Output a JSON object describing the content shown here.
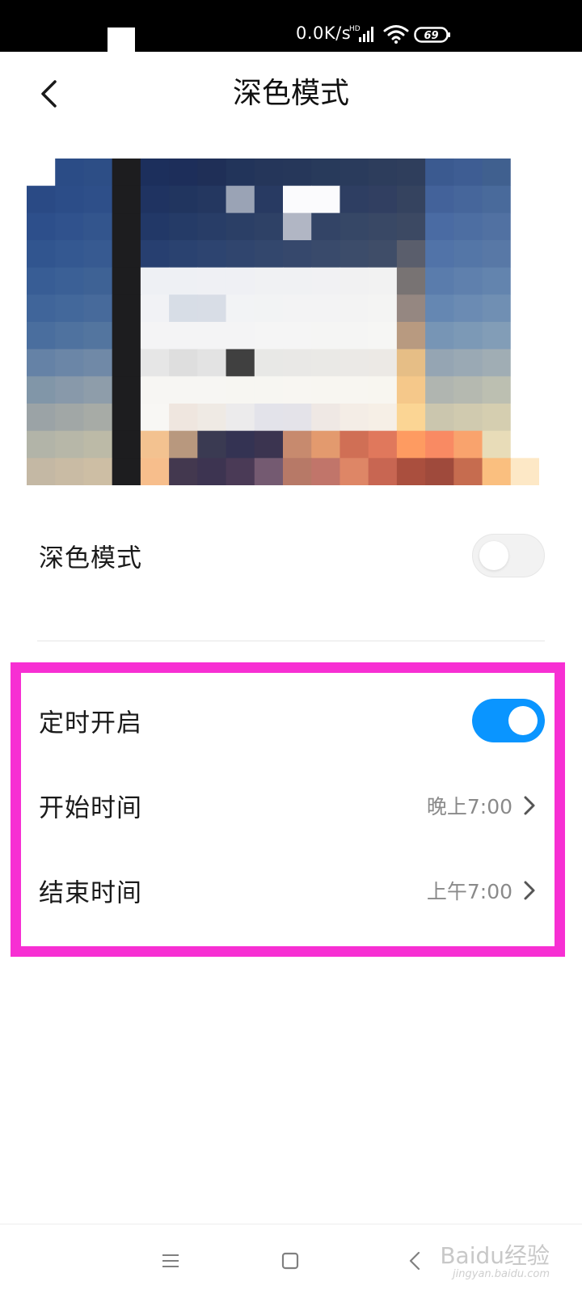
{
  "status_bar": {
    "network_speed": "0.0K/s",
    "signal_badge": "HD",
    "battery_level": "69",
    "icons": [
      "signal-icon",
      "wifi-icon",
      "battery-icon"
    ]
  },
  "header": {
    "title": "深色模式",
    "back_icon": "chevron-left-icon"
  },
  "preview": {
    "pixel_colors": [
      [
        "#ffffff",
        "#2b4c86",
        "#2d4e86",
        "#1d1d1f",
        "#1c2f5c",
        "#1d2e5a",
        "#1f2f57",
        "#22345a",
        "#25365a",
        "#26375a",
        "#283a5b",
        "#2a3b5c",
        "#2d3d5c",
        "#2f3e5c",
        "#3b5a90",
        "#3e5d93",
        "#40608f",
        "#ffffff"
      ],
      [
        "#2a4a85",
        "#2c4d88",
        "#2e4f89",
        "#1d1d1f",
        "#1f3361",
        "#21355f",
        "#243760",
        "#9aa3b5",
        "#283a62",
        "#fbfbfd",
        "#fbfbfd",
        "#2e3e62",
        "#313f61",
        "#35435f",
        "#43629a",
        "#46669b",
        "#496a9b",
        "#ffffff"
      ],
      [
        "#2d4f8b",
        "#30528d",
        "#33558d",
        "#1d1d1f",
        "#223867",
        "#253b67",
        "#283d67",
        "#2b3f66",
        "#2e4166",
        "#b1b6c4",
        "#334466",
        "#364766",
        "#394865",
        "#3c4963",
        "#4a6ba3",
        "#4d6ea2",
        "#5171a2",
        "#ffffff"
      ],
      [
        "#31558f",
        "#345891",
        "#375a91",
        "#1d1d1f",
        "#273f70",
        "#2a4270",
        "#2d4470",
        "#30456e",
        "#33476d",
        "#36486c",
        "#394a6b",
        "#3c4c6a",
        "#3f4d68",
        "#5a5e6c",
        "#5173a8",
        "#5476a7",
        "#5878a6",
        "#ffffff"
      ],
      [
        "#385d95",
        "#3b6096",
        "#3e6295",
        "#1d1d1f",
        "#eef0f4",
        "#eef0f4",
        "#eff0f4",
        "#eff0f4",
        "#f0f1f3",
        "#f0f1f3",
        "#f1f1f3",
        "#f1f1f2",
        "#f2f2f2",
        "#787373",
        "#5a7cac",
        "#5f80ad",
        "#6384ae",
        "#ffffff"
      ],
      [
        "#40659a",
        "#43689b",
        "#476a9b",
        "#1d1d1f",
        "#f1f2f5",
        "#d7dde6",
        "#d8dde6",
        "#f2f3f5",
        "#f2f3f4",
        "#f3f3f4",
        "#f3f3f4",
        "#f3f3f3",
        "#f4f4f3",
        "#958781",
        "#6587b2",
        "#6b8bb3",
        "#708fb3",
        "#ffffff"
      ],
      [
        "#4a6e9e",
        "#4f729f",
        "#53759f",
        "#1d1d1f",
        "#f4f4f5",
        "#f4f4f5",
        "#f4f4f5",
        "#f4f4f5",
        "#f5f5f5",
        "#f5f5f5",
        "#f5f5f4",
        "#f5f5f4",
        "#f6f6f4",
        "#b89a80",
        "#7795b5",
        "#7c99b6",
        "#829db7",
        "#ffffff"
      ],
      [
        "#6582a6",
        "#6b86a7",
        "#7089a7",
        "#1d1d1f",
        "#e6e6e6",
        "#dedede",
        "#e3e3e3",
        "#404040",
        "#e8e8e6",
        "#e9e8e6",
        "#eae9e6",
        "#ebe9e6",
        "#ece9e5",
        "#e6be86",
        "#95a5b3",
        "#9aa9b4",
        "#a0adb4",
        "#ffffff"
      ],
      [
        "#8196a8",
        "#8899aa",
        "#8e9daa",
        "#1d1d1f",
        "#f7f6f3",
        "#f7f6f3",
        "#f7f6f3",
        "#f7f6f2",
        "#f7f6f2",
        "#f8f6f2",
        "#f8f6f1",
        "#f8f6f1",
        "#f8f6f0",
        "#f5c88a",
        "#b0b5b0",
        "#b5b9b0",
        "#bcbfb1",
        "#ffffff"
      ],
      [
        "#9ba3a6",
        "#a1a7a6",
        "#a7aba6",
        "#1d1d1f",
        "#f8f7f4",
        "#efe6df",
        "#efeae4",
        "#ecebec",
        "#e3e3ea",
        "#e4e3e9",
        "#efe8e4",
        "#f4ede6",
        "#f6efe6",
        "#fbd594",
        "#cbc6ae",
        "#d0caaf",
        "#d5ceb0",
        "#ffffff"
      ],
      [
        "#b2b4a8",
        "#b7b7a8",
        "#bcbaa7",
        "#1d1d1f",
        "#f3c290",
        "#b8987e",
        "#3a3a52",
        "#343353",
        "#3b3450",
        "#c78a6e",
        "#e39a6e",
        "#d06f55",
        "#e0785c",
        "#fe9b61",
        "#f98a63",
        "#f9a36d",
        "#e8dcb8",
        "#ffffff"
      ],
      [
        "#c4b8a4",
        "#c9bba4",
        "#cdbea4",
        "#1d1d1f",
        "#f7be8c",
        "#43384f",
        "#3d3451",
        "#4a3a56",
        "#745a71",
        "#b77967",
        "#c1756a",
        "#de8666",
        "#c86652",
        "#aa4f3e",
        "#9f4a3c",
        "#c66c4f",
        "#fabf7f",
        "#fde8c6"
      ]
    ]
  },
  "settings": {
    "dark_mode": {
      "label": "深色模式",
      "enabled": false
    },
    "schedule": {
      "label": "定时开启",
      "enabled": true,
      "accent_color": "#0a95ff"
    },
    "start_time": {
      "label": "开始时间",
      "value": "晚上7:00"
    },
    "end_time": {
      "label": "结束时间",
      "value": "上午7:00"
    },
    "highlight_color": "#f72fd3"
  },
  "nav_bar": {
    "icons": [
      "menu-icon",
      "home-icon",
      "back-icon"
    ]
  },
  "watermark": {
    "text": "Baidu经验",
    "sub": "jingyan.baidu.com"
  }
}
